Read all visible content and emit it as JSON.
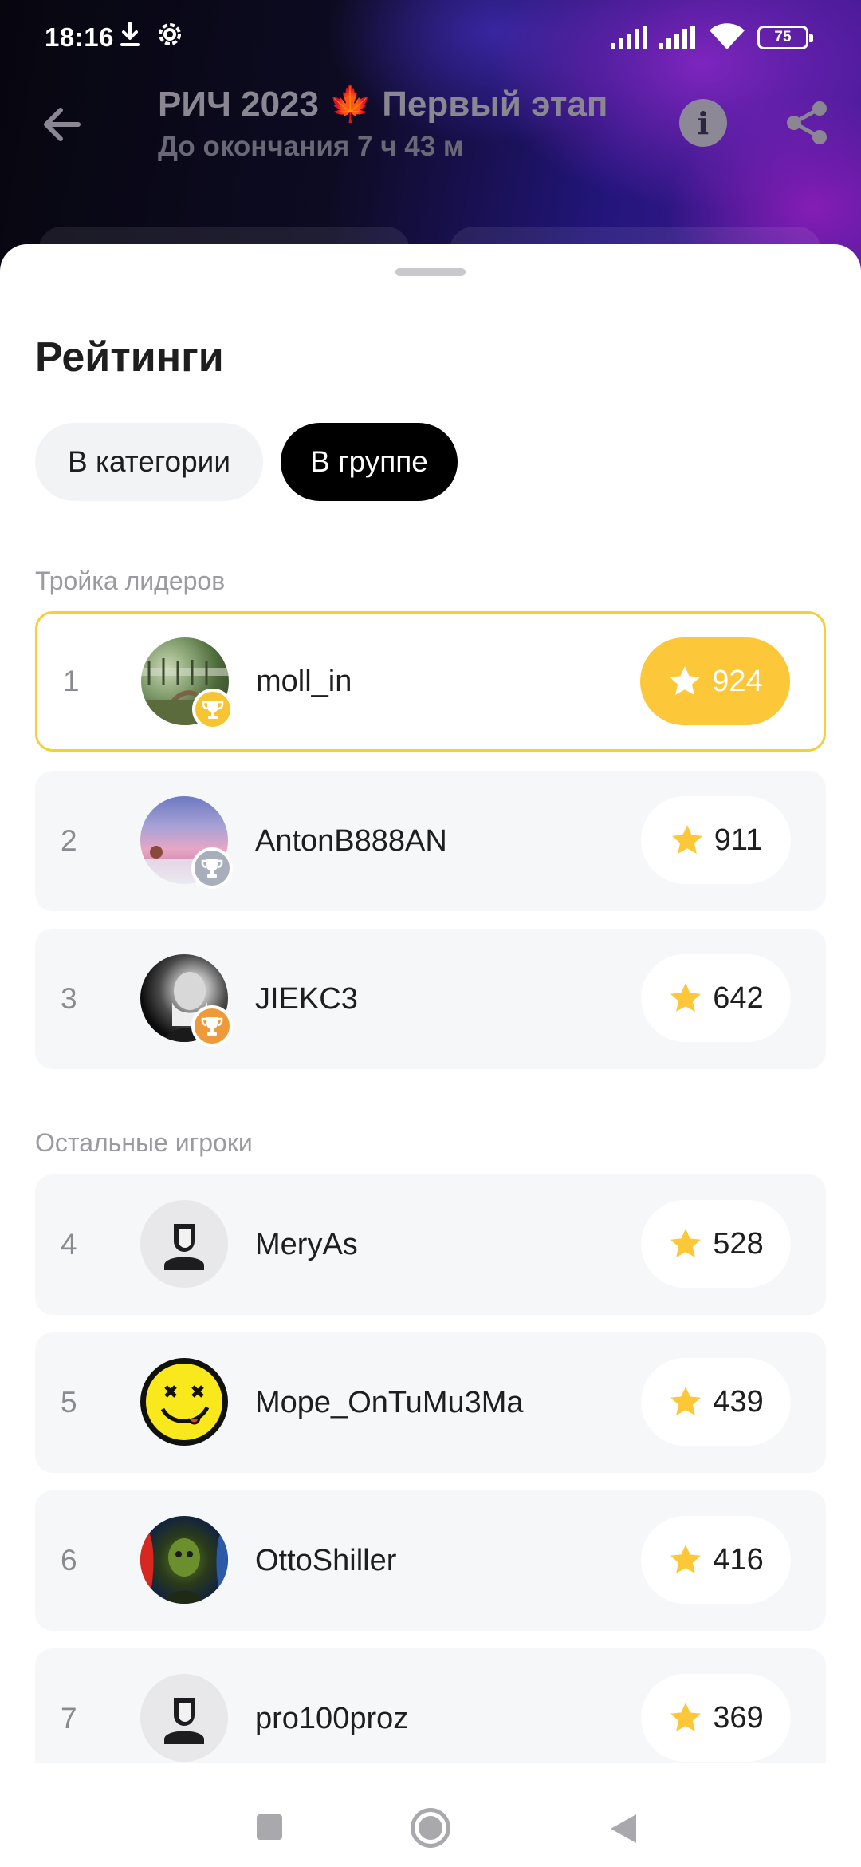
{
  "status_bar": {
    "time": "18:16",
    "battery": "75",
    "icons": [
      "download-icon",
      "settings-icon",
      "signal-icon",
      "signal-icon",
      "wifi-icon",
      "battery-icon"
    ]
  },
  "header": {
    "title": "РИЧ 2023 🍁 Первый этап",
    "countdown": "До окончания 7 ч 43 м",
    "icons": [
      "back-arrow-icon",
      "info-icon",
      "share-icon"
    ]
  },
  "sheet": {
    "title": "Рейтинги",
    "chips": [
      {
        "label": "В категории",
        "selected": false
      },
      {
        "label": "В группе",
        "selected": true
      }
    ],
    "leaders_label": "Тройка лидеров",
    "others_label": "Остальные игроки",
    "score_icon": "star-icon",
    "leaders": [
      {
        "rank": "1",
        "name": "moll_in",
        "score": "924",
        "trophy": "gold",
        "trophy_color": "#f7c531"
      },
      {
        "rank": "2",
        "name": "AntonB888AN",
        "score": "911",
        "trophy": "silver",
        "trophy_color": "#a9aebb"
      },
      {
        "rank": "3",
        "name": "JIEKC3",
        "score": "642",
        "trophy": "bronze",
        "trophy_color": "#ee9a3a"
      }
    ],
    "others": [
      {
        "rank": "4",
        "name": "MeryAs",
        "score": "528"
      },
      {
        "rank": "5",
        "name": "Mope_OnTuMu3Ma",
        "score": "439"
      },
      {
        "rank": "6",
        "name": "OttoShiller",
        "score": "416"
      },
      {
        "rank": "7",
        "name": "pro100proz",
        "score": "369"
      }
    ]
  },
  "colors": {
    "accent_star": "#fdc73a",
    "leader_border": "#f3cf3a",
    "chip_selected": "#000000"
  }
}
